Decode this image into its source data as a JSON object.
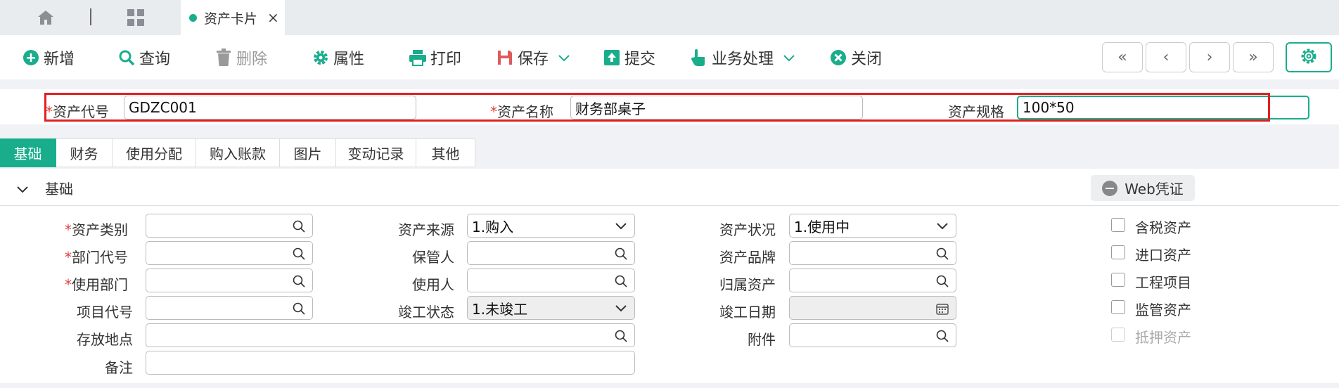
{
  "tabbar": {
    "active_tab": "资产卡片",
    "close": "×"
  },
  "toolbar": {
    "add": "新增",
    "query": "查询",
    "delete": "删除",
    "properties": "属性",
    "print": "打印",
    "save": "保存",
    "submit": "提交",
    "business": "业务处理",
    "close": "关闭",
    "nav": [
      "«",
      "‹",
      "›",
      "»"
    ]
  },
  "header": {
    "asset_code_label": "资产代号",
    "asset_code_value": "GDZC001",
    "asset_name_label": "资产名称",
    "asset_name_value": "财务部桌子",
    "asset_spec_label": "资产规格",
    "asset_spec_value": "100*50"
  },
  "subtabs": [
    "基础",
    "财务",
    "使用分配",
    "购入账款",
    "图片",
    "变动记录",
    "其他"
  ],
  "section": {
    "title": "基础",
    "web_button": "Web凭证"
  },
  "form": {
    "category_label": "资产类别",
    "dept_code_label": "部门代号",
    "use_dept_label": "使用部门",
    "project_code_label": "项目代号",
    "location_label": "存放地点",
    "remark_label": "备注",
    "source_label": "资产来源",
    "source_value": "1.购入",
    "keeper_label": "保管人",
    "user_label": "使用人",
    "completion_status_label": "竣工状态",
    "completion_status_value": "1.未竣工",
    "asset_status_label": "资产状况",
    "asset_status_value": "1.使用中",
    "brand_label": "资产品牌",
    "belong_label": "归属资产",
    "completion_date_label": "竣工日期",
    "attachment_label": "附件"
  },
  "checkboxes": [
    "含税资产",
    "进口资产",
    "工程项目",
    "监管资产",
    "抵押资产"
  ],
  "colors": {
    "accent": "#1aad8c",
    "highlight": "#e02020",
    "required": "#e03c3c"
  }
}
